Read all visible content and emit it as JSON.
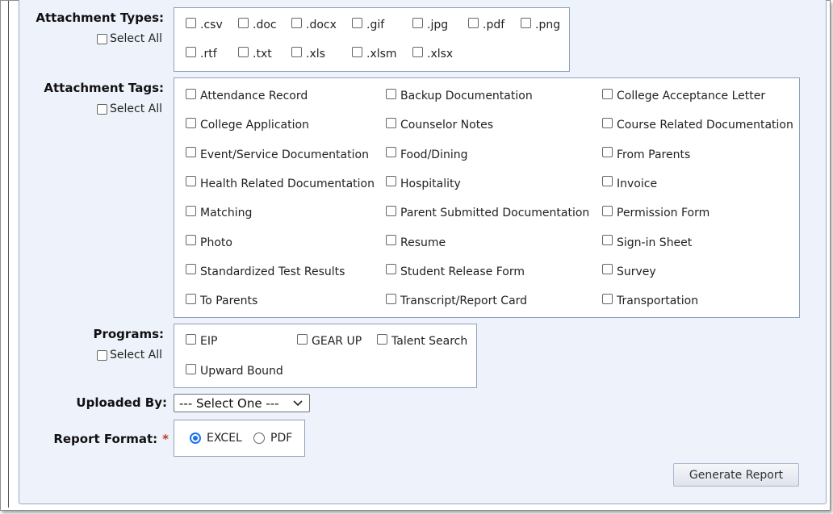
{
  "attachment_types": {
    "label": "Attachment Types:",
    "select_all": "Select All",
    "options": [
      ".csv",
      ".doc",
      ".docx",
      ".gif",
      ".jpg",
      ".pdf",
      ".png",
      ".rtf",
      ".txt",
      ".xls",
      ".xlsm",
      ".xlsx"
    ]
  },
  "attachment_tags": {
    "label": "Attachment Tags:",
    "select_all": "Select All",
    "options": [
      "Attendance Record",
      "Backup Documentation",
      "College Acceptance Letter",
      "College Application",
      "Counselor Notes",
      "Course Related Documentation",
      "Event/Service Documentation",
      "Food/Dining",
      "From Parents",
      "Health Related Documentation",
      "Hospitality",
      "Invoice",
      "Matching",
      "Parent Submitted Documentation",
      "Permission Form",
      "Photo",
      "Resume",
      "Sign-in Sheet",
      "Standardized Test Results",
      "Student Release Form",
      "Survey",
      "To Parents",
      "Transcript/Report Card",
      "Transportation"
    ]
  },
  "programs": {
    "label": "Programs:",
    "select_all": "Select All",
    "options": [
      "EIP",
      "GEAR UP",
      "Talent Search",
      "Upward Bound"
    ]
  },
  "uploaded_by": {
    "label": "Uploaded By:",
    "value": "--- Select One ---"
  },
  "report_format": {
    "label": "Report Format:",
    "required_mark": "*",
    "options": [
      "EXCEL",
      "PDF"
    ],
    "selected": "EXCEL"
  },
  "generate_button": "Generate Report",
  "colors": {
    "panel_bg": "#eef3fb",
    "border": "#8fa0bd",
    "accent": "#1a73e8",
    "required": "#c0392b"
  }
}
